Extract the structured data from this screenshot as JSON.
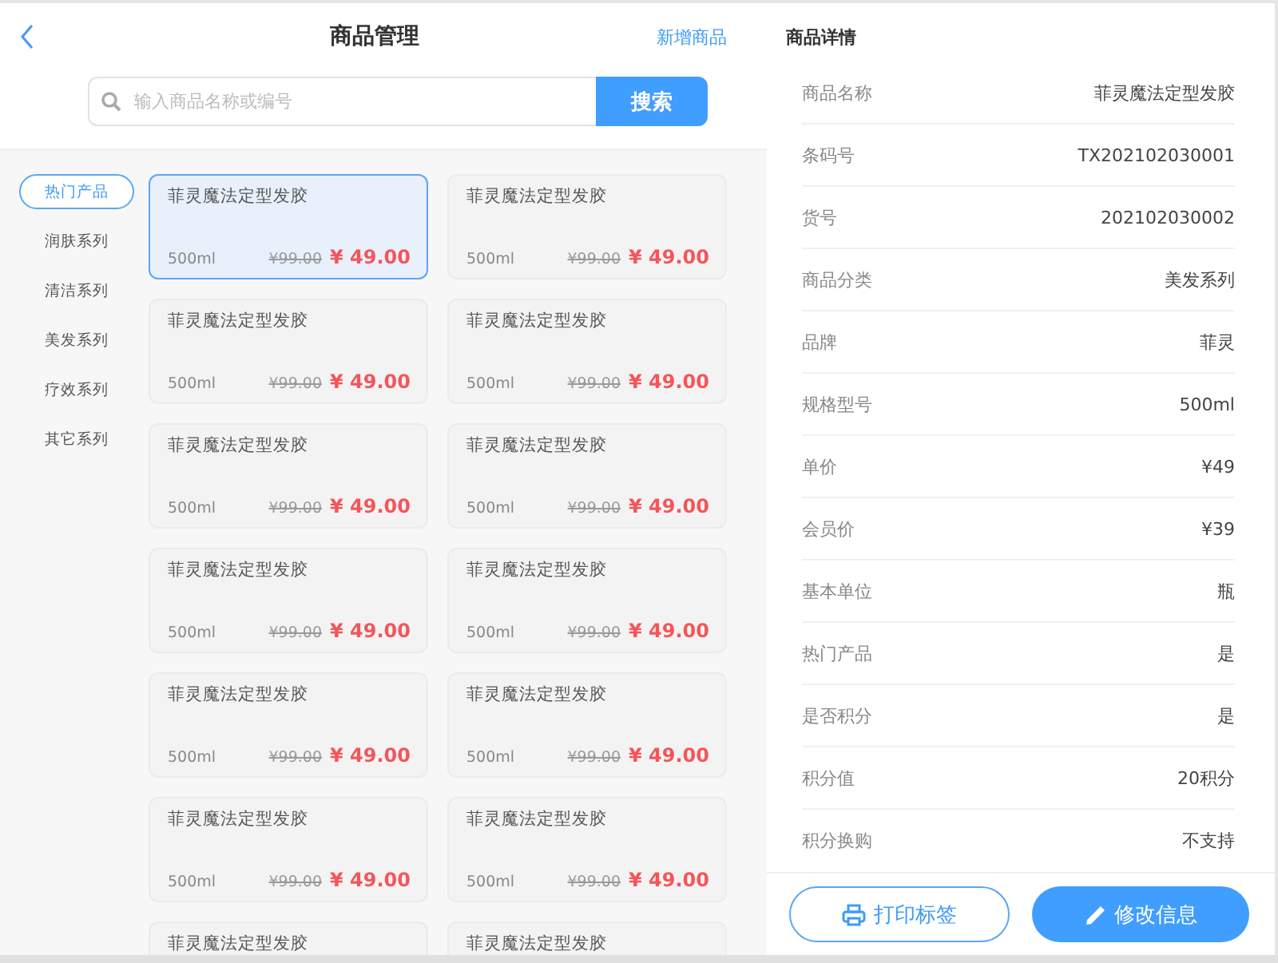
{
  "header": {
    "title": "商品管理",
    "action": "新增商品"
  },
  "search": {
    "placeholder": "输入商品名称或编号",
    "button": "搜索"
  },
  "categories": [
    {
      "label": "热门产品",
      "selected": true
    },
    {
      "label": "润肤系列",
      "selected": false
    },
    {
      "label": "清洁系列",
      "selected": false
    },
    {
      "label": "美发系列",
      "selected": false
    },
    {
      "label": "疗效系列",
      "selected": false
    },
    {
      "label": "其它系列",
      "selected": false
    }
  ],
  "products": [
    {
      "name": "菲灵魔法定型发胶",
      "size": "500ml",
      "original_price": "¥99.00",
      "price": "¥ 49.00",
      "selected": true
    },
    {
      "name": "菲灵魔法定型发胶",
      "size": "500ml",
      "original_price": "¥99.00",
      "price": "¥ 49.00",
      "selected": false
    },
    {
      "name": "菲灵魔法定型发胶",
      "size": "500ml",
      "original_price": "¥99.00",
      "price": "¥ 49.00",
      "selected": false
    },
    {
      "name": "菲灵魔法定型发胶",
      "size": "500ml",
      "original_price": "¥99.00",
      "price": "¥ 49.00",
      "selected": false
    },
    {
      "name": "菲灵魔法定型发胶",
      "size": "500ml",
      "original_price": "¥99.00",
      "price": "¥ 49.00",
      "selected": false
    },
    {
      "name": "菲灵魔法定型发胶",
      "size": "500ml",
      "original_price": "¥99.00",
      "price": "¥ 49.00",
      "selected": false
    },
    {
      "name": "菲灵魔法定型发胶",
      "size": "500ml",
      "original_price": "¥99.00",
      "price": "¥ 49.00",
      "selected": false
    },
    {
      "name": "菲灵魔法定型发胶",
      "size": "500ml",
      "original_price": "¥99.00",
      "price": "¥ 49.00",
      "selected": false
    },
    {
      "name": "菲灵魔法定型发胶",
      "size": "500ml",
      "original_price": "¥99.00",
      "price": "¥ 49.00",
      "selected": false
    },
    {
      "name": "菲灵魔法定型发胶",
      "size": "500ml",
      "original_price": "¥99.00",
      "price": "¥ 49.00",
      "selected": false
    },
    {
      "name": "菲灵魔法定型发胶",
      "size": "500ml",
      "original_price": "¥99.00",
      "price": "¥ 49.00",
      "selected": false
    },
    {
      "name": "菲灵魔法定型发胶",
      "size": "500ml",
      "original_price": "¥99.00",
      "price": "¥ 49.00",
      "selected": false
    },
    {
      "name": "菲灵魔法定型发胶",
      "selected": false
    },
    {
      "name": "菲灵魔法定型发胶",
      "selected": false
    }
  ],
  "details": {
    "title": "商品详情",
    "fields": [
      {
        "label": "商品名称",
        "value": "菲灵魔法定型发胶"
      },
      {
        "label": "条码号",
        "value": "TX202102030001"
      },
      {
        "label": "货号",
        "value": "202102030002"
      },
      {
        "label": "商品分类",
        "value": "美发系列"
      },
      {
        "label": "品牌",
        "value": "菲灵"
      },
      {
        "label": "规格型号",
        "value": "500ml"
      },
      {
        "label": "单价",
        "value": "¥49"
      },
      {
        "label": "会员价",
        "value": "¥39"
      },
      {
        "label": "基本单位",
        "value": "瓶"
      },
      {
        "label": "热门产品",
        "value": "是"
      },
      {
        "label": "是否积分",
        "value": "是"
      },
      {
        "label": "积分值",
        "value": "20积分"
      },
      {
        "label": "积分换购",
        "value": "不支持"
      }
    ],
    "buttons": [
      {
        "label": "打印标签",
        "kind": "outline"
      },
      {
        "label": "修改信息",
        "kind": "primary"
      }
    ]
  }
}
